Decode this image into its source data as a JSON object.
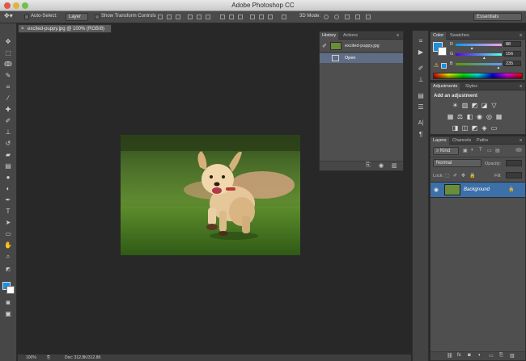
{
  "window": {
    "title": "Adobe Photoshop CC"
  },
  "options_bar": {
    "auto_select_label": "Auto-Select:",
    "auto_select_value": "Layer",
    "show_transform_label": "Show Transform Controls",
    "mode_3d_label": "3D Mode:",
    "workspace_value": "Essentials"
  },
  "document": {
    "tab_label": "excited-puppy.jpg @ 100% (RGB/8)",
    "close_glyph": "×"
  },
  "status_bar": {
    "zoom": "100%",
    "doc_info": "Doc: 312.8K/312.8K"
  },
  "history_panel": {
    "tabs": [
      "History",
      "Actions"
    ],
    "snapshot_label": "excited-puppy.jpg",
    "items": [
      {
        "label": "Open"
      }
    ]
  },
  "color_panel": {
    "tabs": [
      "Color",
      "Swatches"
    ],
    "channels": [
      {
        "label": "R",
        "value": "88",
        "fraction": 0.345
      },
      {
        "label": "G",
        "value": "156",
        "fraction": 0.612
      },
      {
        "label": "B",
        "value": "235",
        "fraction": 0.922
      }
    ]
  },
  "adjustments_panel": {
    "tabs": [
      "Adjustments",
      "Styles"
    ],
    "heading": "Add an adjustment"
  },
  "layers_panel": {
    "tabs": [
      "Layers",
      "Channels",
      "Paths"
    ],
    "filter_value": "Kind",
    "blend_mode": "Normal",
    "opacity_label": "Opacity:",
    "lock_label": "Lock:",
    "fill_label": "Fill:",
    "layers": [
      {
        "name": "Background"
      }
    ]
  },
  "colors": {
    "foreground": "#1a8fe0",
    "background": "#ffffff",
    "selection": "#3d6fa8"
  }
}
